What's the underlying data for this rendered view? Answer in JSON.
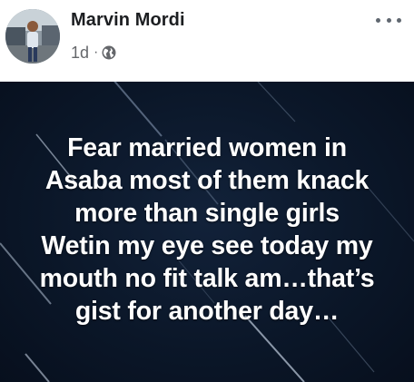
{
  "post": {
    "author_name": "Marvin Mordi",
    "timestamp": "1d",
    "separator": "·",
    "privacy_icon": "globe-icon",
    "more_icon": "more-horizontal-icon",
    "text_lines": [
      "Fear married women in",
      "Asaba most of them knack",
      "more than single girls",
      "Wetin my eye see today my",
      "mouth no fit talk am…that’s",
      "gist for another day…"
    ]
  },
  "colors": {
    "name": "#1c1e21",
    "meta": "#65676b",
    "card_background": "#0b1729",
    "post_text": "#ffffff"
  }
}
